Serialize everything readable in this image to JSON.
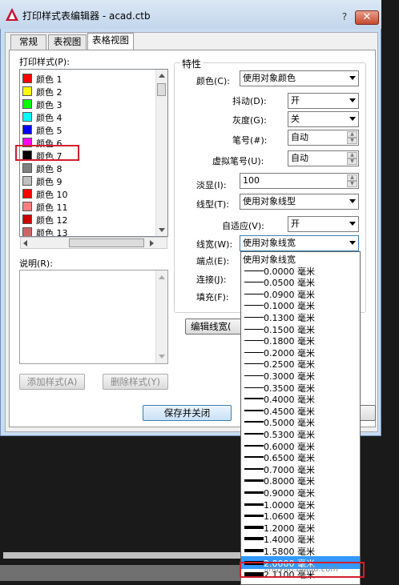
{
  "window": {
    "title": "打印样式表编辑器 - acad.ctb",
    "help": "?",
    "close": "✕"
  },
  "tabs": [
    "常规",
    "表视图",
    "表格视图"
  ],
  "left": {
    "styles_label": "打印样式(P):",
    "styles": [
      {
        "name": "颜色 1",
        "color": "#ff0000"
      },
      {
        "name": "颜色 2",
        "color": "#ffff00"
      },
      {
        "name": "颜色 3",
        "color": "#00ff00"
      },
      {
        "name": "颜色 4",
        "color": "#00ffff"
      },
      {
        "name": "颜色 5",
        "color": "#0000ff"
      },
      {
        "name": "颜色 6",
        "color": "#ff00ff"
      },
      {
        "name": "颜色 7",
        "color": "#000000"
      },
      {
        "name": "颜色 8",
        "color": "#808080"
      },
      {
        "name": "颜色 9",
        "color": "#c0c0c0"
      },
      {
        "name": "颜色 10",
        "color": "#ff0000"
      },
      {
        "name": "颜色 11",
        "color": "#ff7f7f"
      },
      {
        "name": "颜色 12",
        "color": "#cc0000"
      },
      {
        "name": "颜色 13",
        "color": "#cc6666"
      }
    ],
    "description_label": "说明(R):",
    "add_style": "添加样式(A)",
    "delete_style": "删除样式(Y)"
  },
  "properties": {
    "group_title": "特性",
    "color_label": "颜色(C):",
    "color_value": "使用对象颜色",
    "dither_label": "抖动(D):",
    "dither_value": "开",
    "grayscale_label": "灰度(G):",
    "grayscale_value": "关",
    "pen_label": "笔号(#):",
    "pen_value": "自动",
    "vpen_label": "虚拟笔号(U):",
    "vpen_value": "自动",
    "screening_label": "淡显(I):",
    "screening_value": "100",
    "linetype_label": "线型(T):",
    "linetype_value": "使用对象线型",
    "adaptive_label": "自适应(V):",
    "adaptive_value": "开",
    "lineweight_label": "线宽(W):",
    "lineweight_value": "使用对象线宽",
    "endstyle_label": "端点(E):",
    "joinstyle_label": "连接(J):",
    "fill_label": "填充(F):",
    "edit_lineweights": "编辑线宽("
  },
  "lineweight_options": [
    {
      "text": "使用对象线宽",
      "weight": 0
    },
    {
      "text": "0.0000 毫米",
      "weight": 1
    },
    {
      "text": "0.0500 毫米",
      "weight": 1
    },
    {
      "text": "0.0900 毫米",
      "weight": 1
    },
    {
      "text": "0.1000 毫米",
      "weight": 1
    },
    {
      "text": "0.1300 毫米",
      "weight": 1
    },
    {
      "text": "0.1500 毫米",
      "weight": 1
    },
    {
      "text": "0.1800 毫米",
      "weight": 1
    },
    {
      "text": "0.2000 毫米",
      "weight": 1
    },
    {
      "text": "0.2500 毫米",
      "weight": 1
    },
    {
      "text": "0.3000 毫米",
      "weight": 1
    },
    {
      "text": "0.3500 毫米",
      "weight": 1
    },
    {
      "text": "0.4000 毫米",
      "weight": 2
    },
    {
      "text": "0.4500 毫米",
      "weight": 2
    },
    {
      "text": "0.5000 毫米",
      "weight": 2
    },
    {
      "text": "0.5300 毫米",
      "weight": 2
    },
    {
      "text": "0.6000 毫米",
      "weight": 2
    },
    {
      "text": "0.6500 毫米",
      "weight": 2
    },
    {
      "text": "0.7000 毫米",
      "weight": 2
    },
    {
      "text": "0.8000 毫米",
      "weight": 3
    },
    {
      "text": "0.9000 毫米",
      "weight": 3
    },
    {
      "text": "1.0000 毫米",
      "weight": 3
    },
    {
      "text": "1.0600 毫米",
      "weight": 3
    },
    {
      "text": "1.2000 毫米",
      "weight": 4
    },
    {
      "text": "1.4000 毫米",
      "weight": 4
    },
    {
      "text": "1.5800 毫米",
      "weight": 4
    },
    {
      "text": "2.0000 毫米",
      "weight": 5
    },
    {
      "text": "2.1100 毫米",
      "weight": 5
    }
  ],
  "footer": {
    "save_close": "保存并关闭"
  },
  "watermark": "jingyan.baidu.com"
}
